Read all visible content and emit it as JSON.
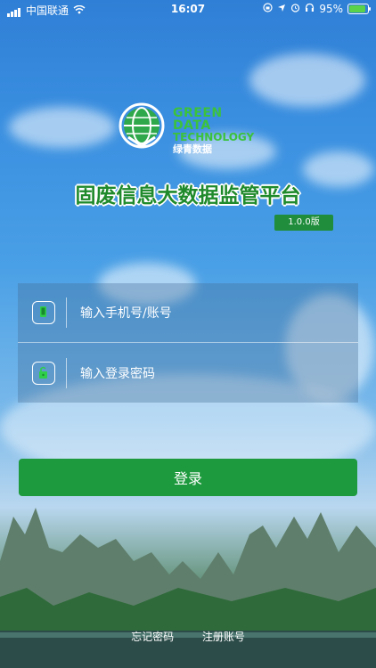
{
  "status_bar": {
    "carrier": "中国联通",
    "time": "16:07",
    "battery": "95%",
    "battery_fraction": 0.95
  },
  "logo": {
    "line1": "GREEN DATA",
    "line2": "TECHNOLOGY",
    "line3": "绿青数据"
  },
  "app": {
    "title": "固废信息大数据监管平台",
    "version": "1.0.0版"
  },
  "form": {
    "account_placeholder": "输入手机号/账号",
    "password_placeholder": "输入登录密码"
  },
  "actions": {
    "login_label": "登录",
    "forgot_label": "忘记密码",
    "register_label": "注册账号"
  },
  "colors": {
    "accent_green": "#1d9a3d",
    "title_green": "#1f8a2b"
  }
}
